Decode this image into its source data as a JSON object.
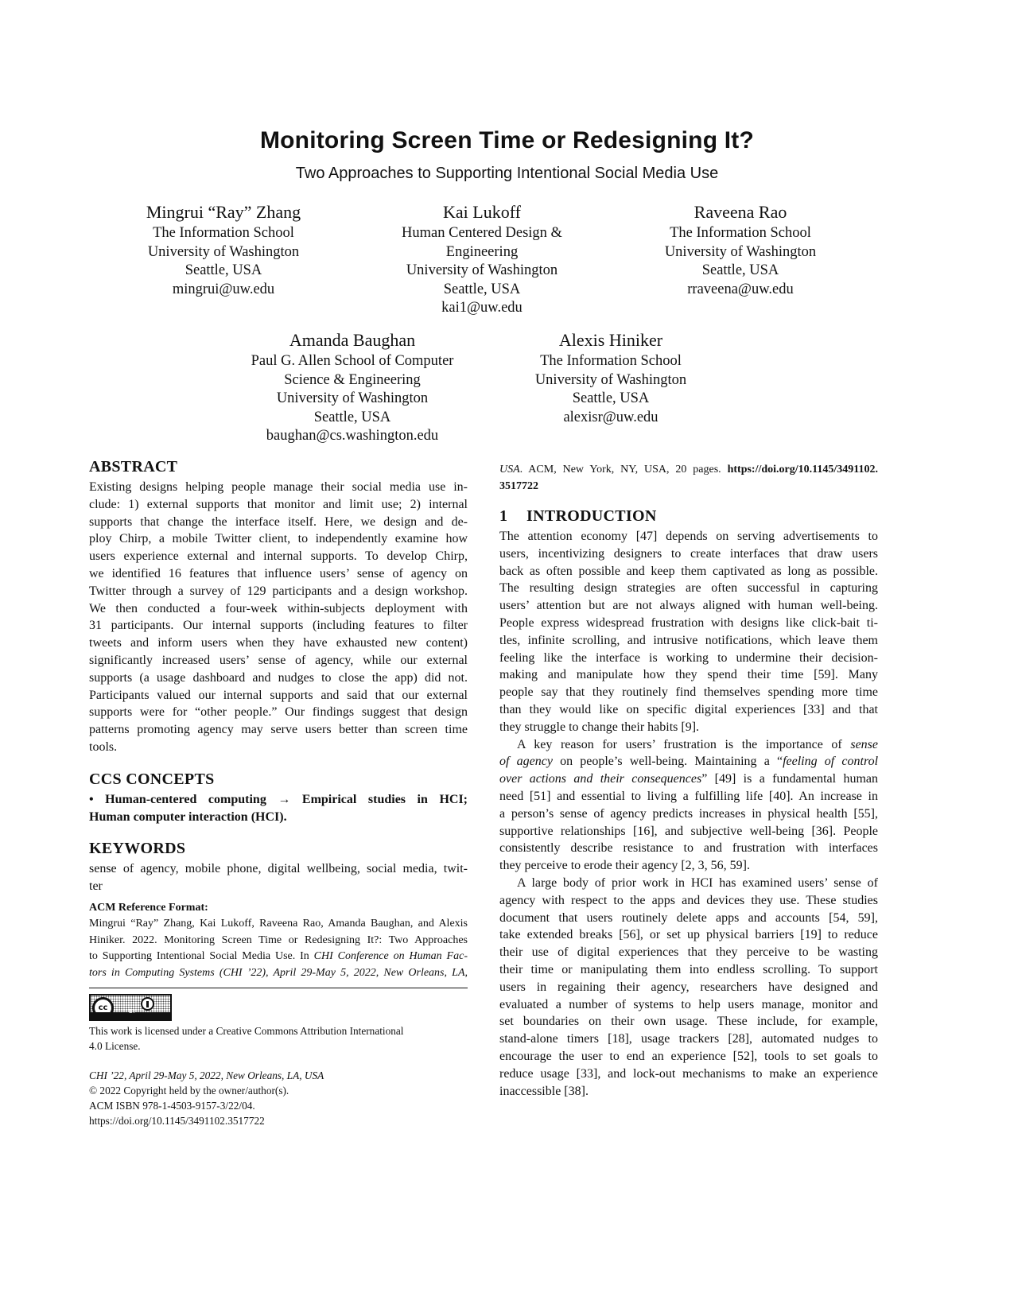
{
  "header": {
    "title": "Monitoring Screen Time or Redesigning It?",
    "subtitle": "Two Approaches to Supporting Intentional Social Media Use"
  },
  "authors": [
    {
      "name": "Mingrui “Ray” Zhang",
      "lines": [
        "The Information School",
        "University of Washington",
        "Seattle, USA",
        "mingrui@uw.edu"
      ]
    },
    {
      "name": "Kai Lukoff",
      "lines": [
        "Human Centered Design &",
        "Engineering",
        "University of Washington",
        "Seattle, USA",
        "kai1@uw.edu"
      ]
    },
    {
      "name": "Raveena Rao",
      "lines": [
        "The Information School",
        "University of Washington",
        "Seattle, USA",
        "rraveena@uw.edu"
      ]
    },
    {
      "name": "Amanda Baughan",
      "lines": [
        "Paul G. Allen School of Computer",
        "Science & Engineering",
        "University of Washington",
        "Seattle, USA",
        "baughan@cs.washington.edu"
      ]
    },
    {
      "name": "Alexis Hiniker",
      "lines": [
        "The Information School",
        "University of Washington",
        "Seattle, USA",
        "alexisr@uw.edu"
      ]
    }
  ],
  "abstract": {
    "heading": "ABSTRACT",
    "lines": [
      "Existing designs helping people manage their social media use in-",
      "clude: 1) external supports that monitor and limit use; 2) internal",
      "supports that change the interface itself. Here, we design and de-",
      "ploy Chirp, a mobile Twitter client, to independently examine how",
      "users experience external and internal supports. To develop Chirp,",
      "we identified 16 features that influence users’ sense of agency on",
      "Twitter through a survey of 129 participants and a design workshop.",
      "We then conducted a four-week within-subjects deployment with",
      "31 participants. Our internal supports (including features to filter",
      "tweets and inform users when they have exhausted new content)",
      "significantly increased users’ sense of agency, while our external",
      "supports (a usage dashboard and nudges to close the app) did not.",
      "Participants valued our internal supports and said that our external",
      "supports were for “other people.” Our findings suggest that design",
      "patterns promoting agency may serve users better than screen time",
      "tools."
    ]
  },
  "ccs": {
    "heading": "CCS CONCEPTS",
    "lines": [
      "• Human-centered computing → Empirical studies in HCI;",
      "Human computer interaction (HCI)."
    ]
  },
  "keywords": {
    "heading": "KEYWORDS",
    "lines": [
      "sense of agency, mobile phone, digital wellbeing, social media, twit-",
      "ter"
    ]
  },
  "acm_reference": {
    "heading": "ACM Reference Format:",
    "line1": "Mingrui “Ray” Zhang, Kai Lukoff, Raveena Rao, Amanda Baughan, and Alexis",
    "line2": "Hiniker. 2022. Monitoring Screen Time or Redesigning It?: Two Approaches",
    "line3": "to Supporting Intentional Social Media Use. In ",
    "line3_italic": "CHI Conference on Human Fac-",
    "line4_italic": "tors in Computing Systems (CHI ’22), April 29-May 5, 2022, New Orleans, LA,",
    "cont_italic": "USA",
    "cont_text": ". ACM, New York, NY, USA, 20 pages. ",
    "cont_link": "https://doi.org/10.1145/3491102.",
    "cont_link2": "3517722"
  },
  "license": {
    "badge_label": "BY",
    "badge_cc": "cc",
    "line1": "This work is licensed under a Creative Commons Attribution International",
    "line2": "4.0 License."
  },
  "footer": {
    "venue": "CHI ’22, April 29-May 5, 2022, New Orleans, LA, USA",
    "copyright": "© 2022 Copyright held by the owner/author(s).",
    "isbn": "ACM ISBN 978-1-4503-9157-3/22/04.",
    "doi": "https://doi.org/10.1145/3491102.3517722"
  },
  "introduction": {
    "number": "1",
    "heading": "INTRODUCTION",
    "p1": [
      "The attention economy [47] depends on serving advertisements to",
      "users, incentivizing designers to create interfaces that draw users",
      "back as often possible and keep them captivated as long as possible.",
      "The resulting design strategies are often successful in capturing",
      "users’ attention but are not always aligned with human well-being.",
      "People express widespread frustration with designs like click-bait ti-",
      "tles, infinite scrolling, and intrusive notifications, which leave them",
      "feeling like the interface is working to undermine their decision-",
      "making and manipulate how they spend their time [59]. Many",
      "people say that they routinely find themselves spending more time",
      "than they would like on specific digital experiences [33] and that",
      "they struggle to change their habits [9]."
    ],
    "p2": {
      "l1_pre": "A key reason for users’ frustration is the importance of ",
      "l1_it": "sense",
      "l2_it": "of agency",
      "l2_post": " on people’s well-being. Maintaining a “",
      "l2_it2": "feeling of control",
      "l3_it": "over actions and their consequences",
      "l3_post": "” [49] is a fundamental human",
      "rest": [
        "need [51] and essential to living a fulfilling life [40]. An increase in",
        "a person’s sense of agency predicts increases in physical health [55],",
        "supportive relationships [16], and subjective well-being [36]. People",
        "consistently describe resistance to and frustration with interfaces",
        "they perceive to erode their agency [2, 3, 56, 59]."
      ]
    },
    "p3": [
      "A large body of prior work in HCI has examined users’ sense of",
      "agency with respect to the apps and devices they use. These studies",
      "document that users routinely delete apps and accounts [54, 59],",
      "take extended breaks [56], or set up physical barriers [19] to reduce",
      "their use of digital experiences that they perceive to be wasting",
      "their time or manipulating them into endless scrolling. To support",
      "users in regaining their agency, researchers have designed and",
      "evaluated a number of systems to help users manage, monitor and",
      "set boundaries on their own usage. These include, for example,",
      "stand-alone timers [18], usage trackers [28], automated nudges to",
      "encourage the user to end an experience [52], tools to set goals to",
      "reduce usage [33], and lock-out mechanisms to make an experience",
      "inaccessible [38]."
    ]
  }
}
